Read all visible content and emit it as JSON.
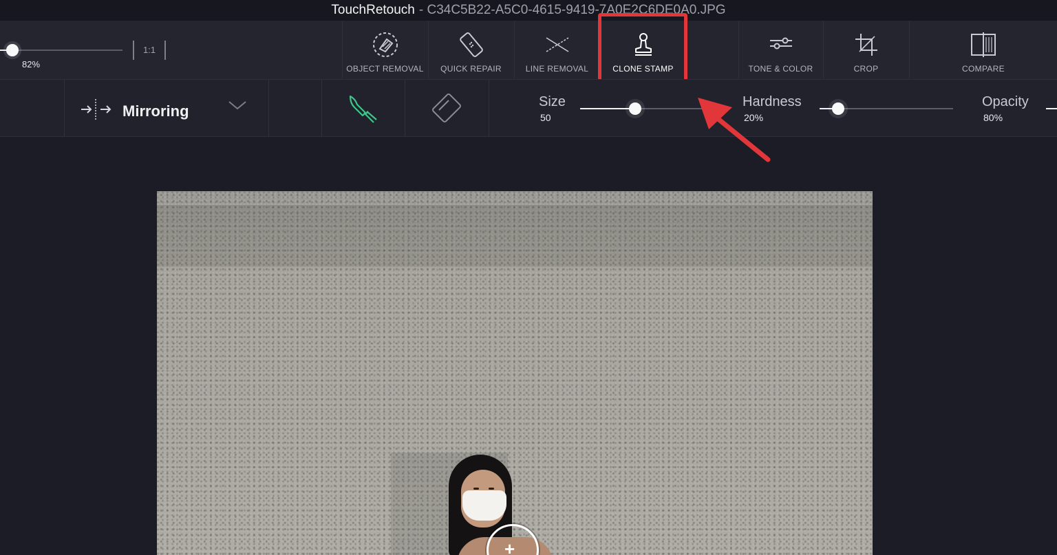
{
  "window": {
    "app_name": "TouchRetouch",
    "file_name": "- C34C5B22-A5C0-4615-9419-7A0E2C6DE0A0.JPG"
  },
  "zoom": {
    "percent_label": "82%",
    "one_to_one_label": "1:1",
    "value_pct": 82
  },
  "tools": [
    {
      "label": "OBJECT REMOVAL",
      "icon": "object-removal-icon"
    },
    {
      "label": "QUICK REPAIR",
      "icon": "bandage-icon"
    },
    {
      "label": "LINE REMOVAL",
      "icon": "line-removal-icon"
    },
    {
      "label": "CLONE STAMP",
      "icon": "stamp-icon",
      "active": true
    },
    {
      "label": "TONE & COLOR",
      "icon": "sliders-icon"
    },
    {
      "label": "CROP",
      "icon": "crop-icon"
    },
    {
      "label": "COMPARE",
      "icon": "compare-icon"
    }
  ],
  "options": {
    "mode_label": "Mirroring",
    "mode_icon": "mirror-icon",
    "size": {
      "label": "Size",
      "value": "50",
      "level": 0.42
    },
    "hardness": {
      "label": "Hardness",
      "value": "20%",
      "level": 0.14
    },
    "opacity": {
      "label": "Opacity",
      "value": "80%"
    }
  },
  "colors": {
    "accent_brush": "#3fc58a",
    "highlight": "#e2373a",
    "annotation_arrow": "#e2373a"
  }
}
